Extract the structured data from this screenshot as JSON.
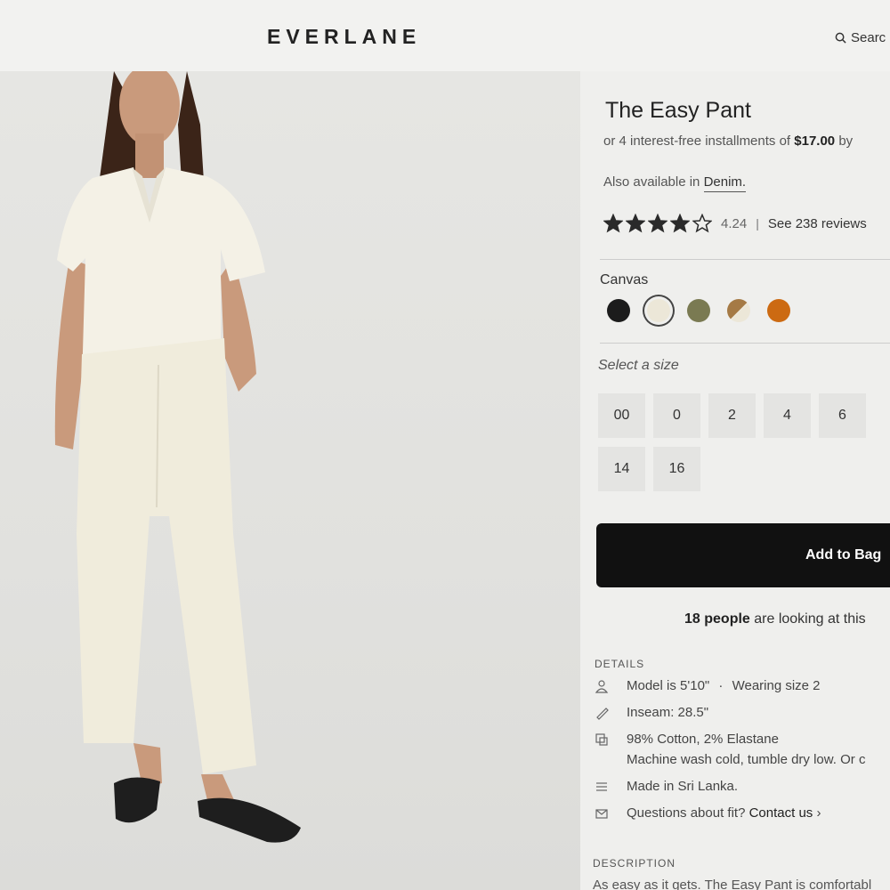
{
  "header": {
    "logo": "EVERLANE",
    "search_label": "Searc"
  },
  "product": {
    "title": "The Easy Pant",
    "installments": {
      "prefix": "or 4 interest-free installments of ",
      "amount": "$17.00",
      "suffix": " by "
    },
    "also_available": {
      "prefix": "Also available in ",
      "link": "Denim."
    },
    "rating": {
      "value": "4.24",
      "separator": "|",
      "reviews_link": "See 238 reviews",
      "stars_filled": 4,
      "stars_total": 5
    },
    "color": {
      "selected_name": "Canvas",
      "swatches": [
        {
          "name": "black",
          "color": "#1c1c1c"
        },
        {
          "name": "canvas",
          "color": "#ece7d8",
          "selected": true
        },
        {
          "name": "olive",
          "color": "#7a7a52"
        },
        {
          "name": "tan-black",
          "color": "#a57a45"
        },
        {
          "name": "orange",
          "color": "#cc6a12"
        }
      ]
    },
    "size": {
      "label": "Select a size",
      "options": [
        "00",
        "0",
        "2",
        "4",
        "6",
        "14",
        "16"
      ]
    },
    "add_to_bag": "Add to Bag",
    "looking": {
      "count": "18 people",
      "suffix": " are looking at this"
    },
    "details": {
      "heading": "DETAILS",
      "model": "Model is 5'10\"",
      "model_sep": "·",
      "wearing": "Wearing size 2",
      "inseam": "Inseam: 28.5\"",
      "fabric": "98% Cotton, 2% Elastane",
      "care": "Machine wash cold, tumble dry low. Or c",
      "origin": "Made in Sri Lanka.",
      "fit_question": "Questions about fit?",
      "contact_link": "Contact us",
      "contact_chevron": "›"
    },
    "description": {
      "heading": "DESCRIPTION",
      "text": "As easy as it gets. The Easy Pant is comfortabl"
    }
  },
  "icons": {
    "search": "search-icon",
    "person": "person-icon",
    "ruler": "ruler-icon",
    "fabric": "fabric-tag-icon",
    "list": "list-icon",
    "mail": "mail-icon"
  }
}
